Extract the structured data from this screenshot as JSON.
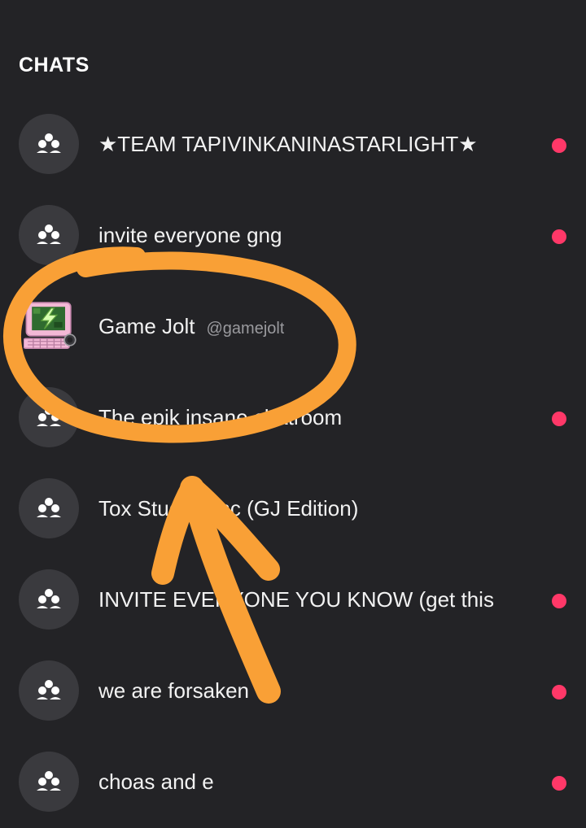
{
  "section": {
    "title": "CHATS"
  },
  "chats": [
    {
      "name": "★TEAM TAPIVINKANINASTARLIGHT★",
      "handle": "",
      "unread": true,
      "avatar": "group-icon"
    },
    {
      "name": "invite everyone gng",
      "handle": "",
      "unread": true,
      "avatar": "group-icon"
    },
    {
      "name": "Game Jolt",
      "handle": "@gamejolt",
      "unread": false,
      "avatar": "game-jolt-avatar"
    },
    {
      "name": "The epik insane chatroom",
      "handle": "",
      "unread": true,
      "avatar": "group-icon"
    },
    {
      "name": "Tox Studios.inc (GJ Edition)",
      "handle": "",
      "unread": false,
      "avatar": "group-icon"
    },
    {
      "name": "INVITE EVERYONE YOU KNOW (get this",
      "handle": "",
      "unread": true,
      "avatar": "group-icon"
    },
    {
      "name": "we are forsaken",
      "handle": "",
      "unread": true,
      "avatar": "group-icon"
    },
    {
      "name": "choas and e",
      "handle": "",
      "unread": true,
      "avatar": "group-icon"
    }
  ],
  "colors": {
    "background": "#232326",
    "avatar_bg": "#3a3a3e",
    "unread_dot": "#ff3868",
    "annotation": "#f9a036"
  }
}
